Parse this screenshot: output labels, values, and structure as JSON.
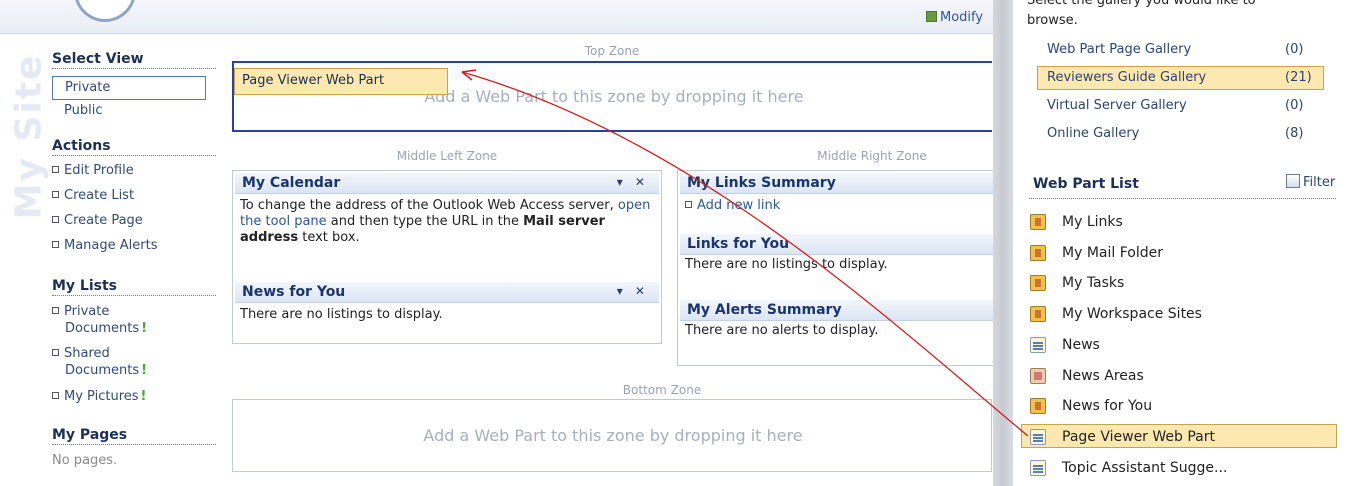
{
  "header": {
    "modify_label": "Modify"
  },
  "sidebar": {
    "watermark": "My Site",
    "select_view": {
      "heading": "Select View",
      "options": [
        "Private",
        "Public"
      ],
      "selected": "Private"
    },
    "actions": {
      "heading": "Actions",
      "items": [
        "Edit Profile",
        "Create List",
        "Create Page",
        "Manage Alerts"
      ]
    },
    "my_lists": {
      "heading": "My Lists",
      "items": [
        {
          "line1": "Private",
          "line2": "Documents",
          "new_badge": "!"
        },
        {
          "line1": "Shared",
          "line2": "Documents",
          "new_badge": "!"
        },
        {
          "line1": "My Pictures",
          "line2": "",
          "new_badge": "!"
        }
      ]
    },
    "my_pages": {
      "heading": "My Pages",
      "empty_text": "No pages."
    }
  },
  "zones": {
    "top": {
      "label": "Top Zone",
      "drop_hint": "Add a Web Part to this zone by dropping it here",
      "dragging_part": "Page Viewer Web Part"
    },
    "middle_left": {
      "label": "Middle Left Zone",
      "parts": [
        {
          "title": "My Calendar",
          "controls": "▾ ✕",
          "body_pre": "To change the address of the Outlook Web Access server, ",
          "body_link": "open the tool pane",
          "body_mid": " and then type the URL in the ",
          "body_bold": "Mail server address",
          "body_post": " text box."
        },
        {
          "title": "News for You",
          "controls": "▾ ✕",
          "body": "There are no listings to display."
        }
      ]
    },
    "middle_right": {
      "label": "Middle Right Zone",
      "parts": [
        {
          "title": "My Links Summary",
          "body_link": "Add new link"
        },
        {
          "title": "Links for You",
          "body": "There are no listings to display."
        },
        {
          "title": "My Alerts Summary",
          "body": "There are no alerts to display."
        }
      ]
    },
    "bottom": {
      "label": "Bottom Zone",
      "drop_hint": "Add a Web Part to this zone by dropping it here"
    }
  },
  "tool_pane": {
    "intro_line1": "Select the gallery you would like to",
    "intro_line2": "browse.",
    "galleries": [
      {
        "name": "Web Part Page Gallery",
        "count": "(0)"
      },
      {
        "name": "Reviewers Guide Gallery",
        "count": "(21)",
        "selected": true
      },
      {
        "name": "Virtual Server Gallery",
        "count": "(0)"
      },
      {
        "name": "Online Gallery",
        "count": "(8)"
      }
    ],
    "web_part_list": {
      "heading": "Web Part List",
      "filter_label": "Filter",
      "items": [
        {
          "label": "My Links",
          "icon": "webpart-icon"
        },
        {
          "label": "My Mail Folder",
          "icon": "webpart-icon"
        },
        {
          "label": "My Tasks",
          "icon": "webpart-icon"
        },
        {
          "label": "My Workspace Sites",
          "icon": "webpart-icon"
        },
        {
          "label": "News",
          "icon": "document-icon"
        },
        {
          "label": "News Areas",
          "icon": "areas-icon"
        },
        {
          "label": "News for You",
          "icon": "webpart-icon"
        },
        {
          "label": "Page Viewer Web Part",
          "icon": "pageviewer-icon",
          "selected": true
        },
        {
          "label": "Topic Assistant Sugge...",
          "icon": "document-icon"
        }
      ]
    }
  },
  "colors": {
    "highlight_fill": "#fde9b0",
    "highlight_border": "#c8a34a",
    "drag_arrow": "#d02020",
    "top_zone_border": "#2b3fa5",
    "link": "#2a55a0"
  }
}
